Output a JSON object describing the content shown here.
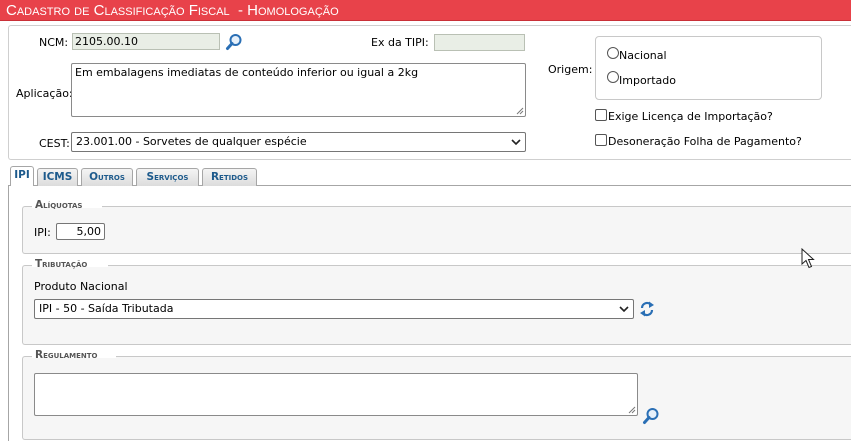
{
  "title": "Cadastro de Classificação Fiscal  - Homologação",
  "header": {
    "ncm_label": "NCM:",
    "ncm_value": "2105.00.10",
    "ex_tipi_label": "Ex da TIPI:",
    "ex_tipi_value": "",
    "aplicacao_label": "Aplicação:",
    "aplicacao_value": "Em embalagens imediatas de conteúdo inferior ou igual a 2kg",
    "cest_label": "CEST:",
    "cest_value": "23.001.00 - Sorvetes de qualquer espécie",
    "origem_label": "Origem:",
    "origem_options": [
      "Nacional",
      "Importado"
    ],
    "exige_licenca_label": "Exige Licença de Importação?",
    "desoneracao_label": "Desoneração Folha de Pagamento?"
  },
  "tabs": [
    {
      "label": "IPI",
      "active": true
    },
    {
      "label": "ICMS",
      "active": false
    },
    {
      "label": "Outros",
      "active": false
    },
    {
      "label": "Serviços",
      "active": false
    },
    {
      "label": "Retidos",
      "active": false
    }
  ],
  "ipi": {
    "aliquotas_legend": "Alíquotas",
    "ipi_label": "IPI:",
    "ipi_value": "5,00",
    "tributacao_legend": "Tributação",
    "produto_label": "Produto Nacional",
    "tributacao_value": "IPI - 50 - Saída Tributada",
    "regulamento_legend": "Regulamento",
    "regulamento_value": ""
  },
  "icons": {
    "search": "magnifier-icon",
    "refresh": "refresh-arrows-icon",
    "cursor": "mouse-pointer"
  },
  "colors": {
    "title_bar": "#e8424a",
    "tab_text": "#1d5a8c",
    "search_icon": "#2a6fb5"
  }
}
